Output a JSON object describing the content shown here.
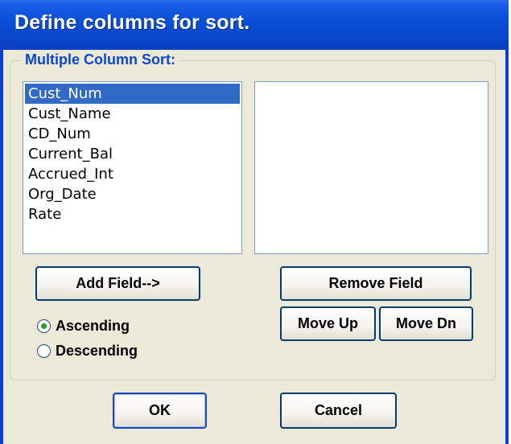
{
  "window": {
    "title": "Define columns for sort."
  },
  "group": {
    "label": "Multiple Column Sort:"
  },
  "available_fields": [
    {
      "label": "Cust_Num",
      "selected": true
    },
    {
      "label": "Cust_Name",
      "selected": false
    },
    {
      "label": "CD_Num",
      "selected": false
    },
    {
      "label": "Current_Bal",
      "selected": false
    },
    {
      "label": "Accrued_Int",
      "selected": false
    },
    {
      "label": "Org_Date",
      "selected": false
    },
    {
      "label": "Rate",
      "selected": false
    }
  ],
  "sort_fields": [],
  "buttons": {
    "add_field": "Add Field-->",
    "remove_field": "Remove Field",
    "move_up": "Move Up",
    "move_dn": "Move Dn",
    "ok": "OK",
    "cancel": "Cancel"
  },
  "order": {
    "ascending": "Ascending",
    "descending": "Descending",
    "selected": "ascending"
  },
  "colors": {
    "title_bar": "#0a48cc",
    "group_label": "#0a46d5",
    "selection": "#316ac5",
    "dialog_bg": "#ece9d8"
  }
}
